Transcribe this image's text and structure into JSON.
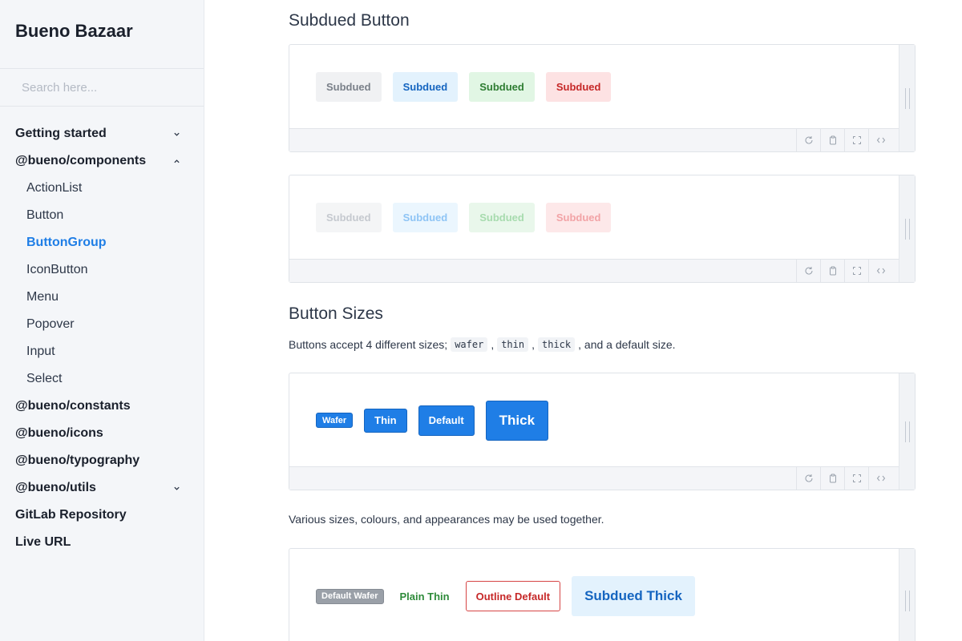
{
  "sidebar": {
    "brand": "Bueno Bazaar",
    "search_placeholder": "Search here...",
    "items": [
      {
        "label": "Getting started",
        "level": 0,
        "chevron": "down"
      },
      {
        "label": "@bueno/components",
        "level": 0,
        "chevron": "up"
      },
      {
        "label": "ActionList",
        "level": 1
      },
      {
        "label": "Button",
        "level": 1
      },
      {
        "label": "ButtonGroup",
        "level": 1,
        "active": true
      },
      {
        "label": "IconButton",
        "level": 1
      },
      {
        "label": "Menu",
        "level": 1
      },
      {
        "label": "Popover",
        "level": 1
      },
      {
        "label": "Input",
        "level": 1
      },
      {
        "label": "Select",
        "level": 1
      },
      {
        "label": "@bueno/constants",
        "level": 0
      },
      {
        "label": "@bueno/icons",
        "level": 0
      },
      {
        "label": "@bueno/typography",
        "level": 0
      },
      {
        "label": "@bueno/utils",
        "level": 0,
        "chevron": "down"
      },
      {
        "label": "GitLab Repository",
        "level": 0
      },
      {
        "label": "Live URL",
        "level": 0
      }
    ]
  },
  "main": {
    "subdued_heading": "Subdued Button",
    "subdued_buttons": [
      "Subdued",
      "Subdued",
      "Subdued",
      "Subdued"
    ],
    "subdued_disabled_buttons": [
      "Subdued",
      "Subdued",
      "Subdued",
      "Subdued"
    ],
    "sizes_heading": "Button Sizes",
    "sizes_text_before": "Buttons accept 4 different sizes;",
    "sizes_codes": [
      "wafer",
      "thin",
      "thick"
    ],
    "sizes_text_after": ", and a default size.",
    "size_buttons": [
      "Wafer",
      "Thin",
      "Default",
      "Thick"
    ],
    "combo_text": "Various sizes, colours, and appearances may be used together.",
    "combo_buttons": [
      "Default Wafer",
      "Plain Thin",
      "Outline Default",
      "Subdued Thick"
    ]
  },
  "colors": {
    "accent": "#1f7ee6",
    "sidebar_bg": "#f4f6f9",
    "subdued_gray_text": "#7a8089",
    "subdued_blue_text": "#1565c0",
    "subdued_green_text": "#2e7d32",
    "subdued_red_text": "#c62828"
  },
  "icons": {
    "toolbar": [
      "refresh-icon",
      "clipboard-icon",
      "fullscreen-icon",
      "code-icon"
    ],
    "collapsed": "chevron-down-icon",
    "expanded": "chevron-up-icon"
  }
}
